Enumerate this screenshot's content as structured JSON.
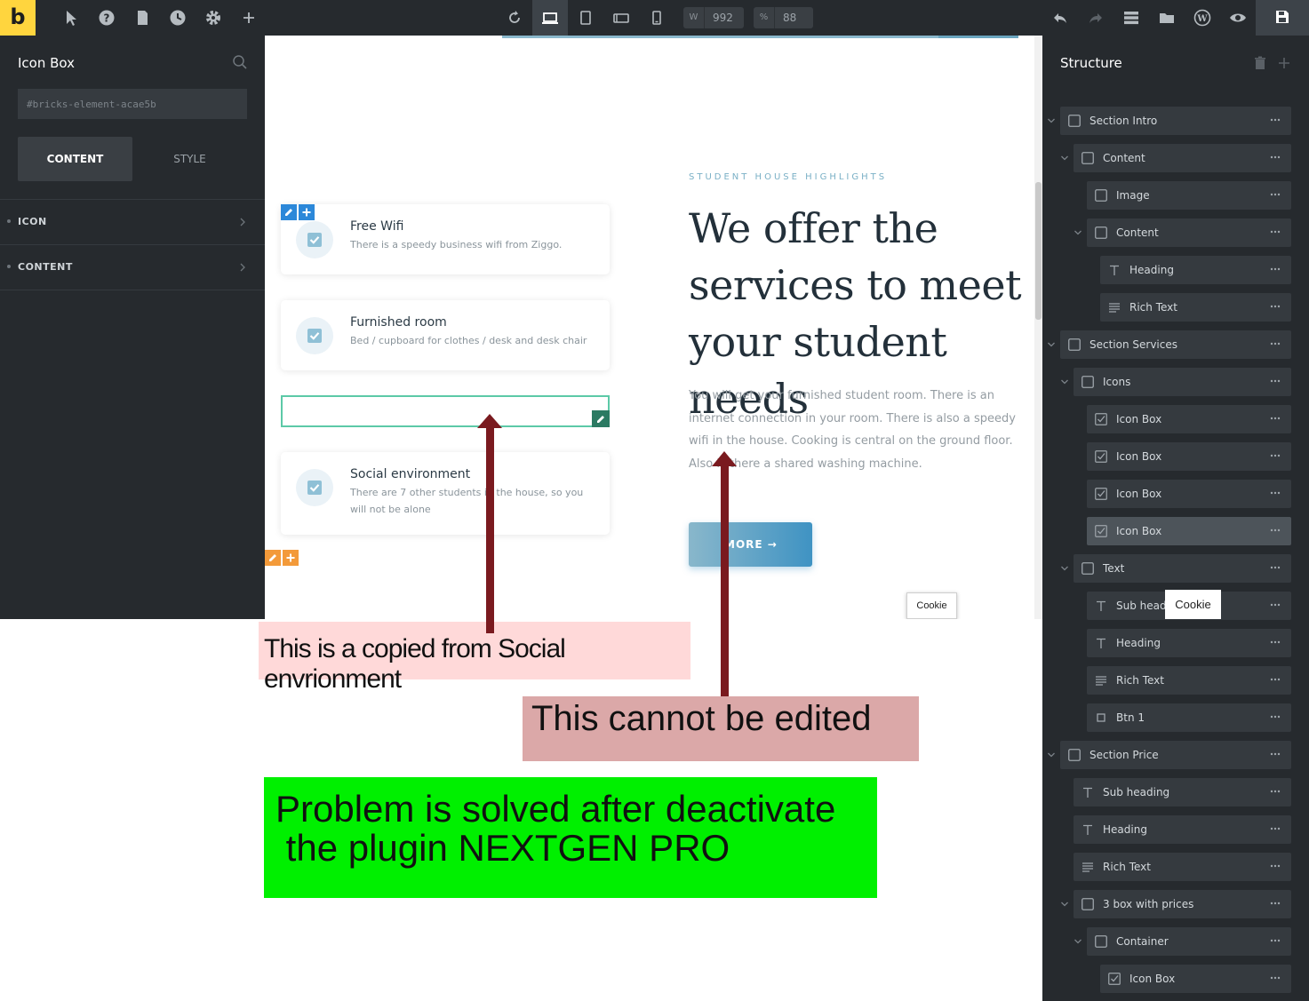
{
  "toolbar": {
    "logo": "b",
    "width_label": "W",
    "width_value": "992",
    "scale_label": "%",
    "scale_value": "88"
  },
  "left_panel": {
    "title": "Icon Box",
    "css_id_placeholder": "#bricks-element-acae5b",
    "tabs": {
      "content": "CONTENT",
      "style": "STYLE"
    },
    "accordions": [
      "ICON",
      "CONTENT"
    ]
  },
  "canvas": {
    "cards": [
      {
        "title": "Free Wifi",
        "text": "There is a speedy business wifi from Ziggo."
      },
      {
        "title": "Furnished room",
        "text": "Bed / cupboard for clothes / desk and desk chair"
      },
      {
        "title": "Social environment",
        "text": "There are 7 other students in the house, so you will not be alone"
      }
    ],
    "eyebrow": "STUDENT HOUSE HIGHLIGHTS",
    "heading": "We offer the services to meet your student needs",
    "body": "You will get your furnished student room. There is an internet connection in your room. There is also a speedy wifi in the house. Cooking is central on the ground floor. Also is there a shared washing machine.",
    "button": "MORE →",
    "cookie": "Cookie"
  },
  "structure": {
    "title": "Structure",
    "cookie": "Cookie",
    "items": [
      {
        "label": "Section Intro",
        "icon": "box-icon"
      },
      {
        "label": "Content",
        "icon": "box-icon"
      },
      {
        "label": "Image",
        "icon": "box-icon"
      },
      {
        "label": "Content",
        "icon": "box-icon"
      },
      {
        "label": "Heading",
        "icon": "text-icon"
      },
      {
        "label": "Rich Text",
        "icon": "lines-icon"
      },
      {
        "label": "Section Services",
        "icon": "box-icon"
      },
      {
        "label": "Icons",
        "icon": "box-icon"
      },
      {
        "label": "Icon Box",
        "icon": "checkbox-icon"
      },
      {
        "label": "Icon Box",
        "icon": "checkbox-icon"
      },
      {
        "label": "Icon Box",
        "icon": "checkbox-icon"
      },
      {
        "label": "Icon Box",
        "icon": "checkbox-icon",
        "active": true
      },
      {
        "label": "Text",
        "icon": "box-icon"
      },
      {
        "label": "Sub heading",
        "icon": "text-icon"
      },
      {
        "label": "Heading",
        "icon": "text-icon"
      },
      {
        "label": "Rich Text",
        "icon": "lines-icon"
      },
      {
        "label": "Btn 1",
        "icon": "small-box-icon"
      },
      {
        "label": "Section Price",
        "icon": "box-icon"
      },
      {
        "label": "Sub heading",
        "icon": "text-icon"
      },
      {
        "label": "Heading",
        "icon": "text-icon"
      },
      {
        "label": "Rich Text",
        "icon": "lines-icon"
      },
      {
        "label": "3 box with prices",
        "icon": "box-icon"
      },
      {
        "label": "Container",
        "icon": "box-icon"
      },
      {
        "label": "Icon Box",
        "icon": "checkbox-icon"
      }
    ]
  },
  "annotations": {
    "copied": "This is a copied from Social envrionment",
    "cannot_edit": "This cannot be edited",
    "solved": "Problem is solved after deactivate\n the plugin NEXTGEN PRO"
  },
  "colors": {
    "dark_panel": "#262a2e",
    "row": "#353a3f",
    "logo": "#ffd53e",
    "accent_blue": "#3f93c3",
    "selection_green": "#5cc9a7",
    "arrow": "#7a1a1f",
    "note_green": "#00f000"
  }
}
